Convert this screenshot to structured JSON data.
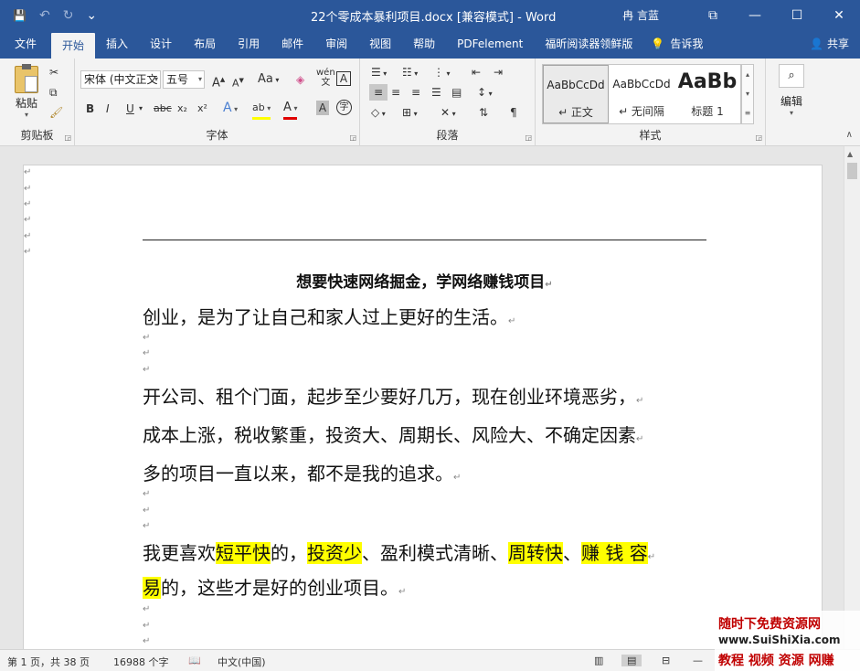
{
  "window": {
    "title": "22个零成本暴利项目.docx [兼容模式]  -  Word",
    "user": "冉 言蓝",
    "controls": {
      "ribbon_display": "⧉",
      "minimize": "—",
      "maximize": "☐",
      "close": "✕"
    }
  },
  "qat": {
    "save": "💾",
    "undo": "↶",
    "redo": "↻",
    "customize": "⌄"
  },
  "tabs": [
    "文件",
    "开始",
    "插入",
    "设计",
    "布局",
    "引用",
    "邮件",
    "审阅",
    "视图",
    "帮助",
    "PDFelement",
    "福昕阅读器领鲜版"
  ],
  "tab_active": "开始",
  "tell_me": "告诉我",
  "share": "共享",
  "ribbon": {
    "clipboard": {
      "label": "剪贴板",
      "paste": "粘贴"
    },
    "font": {
      "label": "字体",
      "font_name": "宋体 (中文正文",
      "font_size": "五号",
      "change_case": "Aa",
      "bold": "B",
      "italic": "I",
      "underline": "U",
      "strike": "abc",
      "subscript": "x₂",
      "superscript": "x²"
    },
    "paragraph": {
      "label": "段落"
    },
    "styles": {
      "label": "样式",
      "items": [
        {
          "preview": "AaBbCcDd",
          "name": "↵ 正文"
        },
        {
          "preview": "AaBbCcDd",
          "name": "↵ 无间隔"
        },
        {
          "preview": "AaBb",
          "name": "标题 1"
        }
      ]
    },
    "editing": {
      "label": "编辑"
    }
  },
  "document": {
    "title": "想要快速网络掘金，学网络赚钱项目",
    "line1": "创业，是为了让自己和家人过上更好的生活。",
    "line2": "开公司、租个门面，起步至少要好几万，现在创业环境恶劣，",
    "line3": "成本上涨，税收繁重，投资大、周期长、风险大、不确定因素",
    "line4": "多的项目一直以来，都不是我的追求。",
    "line5": {
      "p1": "我更喜欢",
      "h1": "短平快",
      "p2": "的，",
      "h2": "投资少",
      "p3": "、盈利模式清晰、",
      "h3": "周转快",
      "p4": "、",
      "h4": "赚 钱 容"
    },
    "line6": {
      "h5": "易",
      "p5": "的，这些才是好的创业项目。"
    },
    "paragraph_mark": "↵"
  },
  "status_bar": {
    "page": "第 1 页，共 38 页",
    "words": "16988 个字",
    "language": "中文(中国)"
  },
  "watermark": {
    "line1": "随时下免费资源网",
    "line2": "www.SuiShiXia.com",
    "line3": "教程 视频 资源 网赚"
  }
}
